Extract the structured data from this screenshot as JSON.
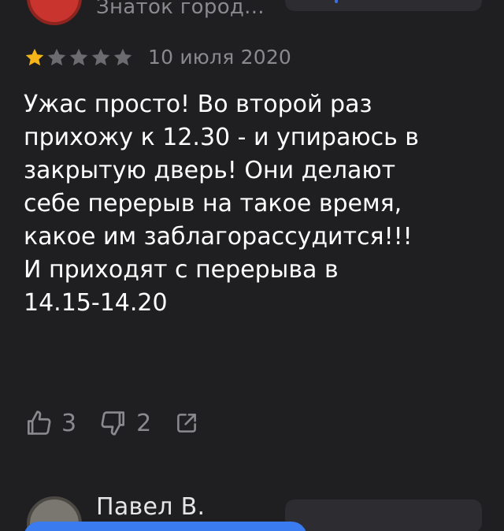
{
  "previous_review": {
    "author_name": "Знаток город..."
  },
  "review": {
    "rating": 1,
    "rating_max": 5,
    "date": "10 июля 2020",
    "text": "Ужас просто! Во второй раз\nприхожу к 12.30 - и упираюсь в\nзакрытую дверь! Они делают\nсебе перерыв на такое время,\nкакое им заблагорассудится!!!\nИ приходят с перерыва в\n14.15-14.20",
    "likes": "3",
    "dislikes": "2"
  },
  "next_review": {
    "author_name": "Павел В."
  },
  "icons": {
    "star_filled": "star-filled-icon",
    "star_empty": "star-empty-icon",
    "like": "thumbs-up-icon",
    "dislike": "thumbs-down-icon",
    "share": "share-icon"
  },
  "colors": {
    "background": "#1f1f22",
    "star_filled": "#f5b417",
    "star_empty": "#6b6b70",
    "muted_text": "#8a8a8e",
    "primary_text": "#ffffff",
    "accent_blue": "#3a7bf0",
    "avatar_red": "#c9342e"
  }
}
